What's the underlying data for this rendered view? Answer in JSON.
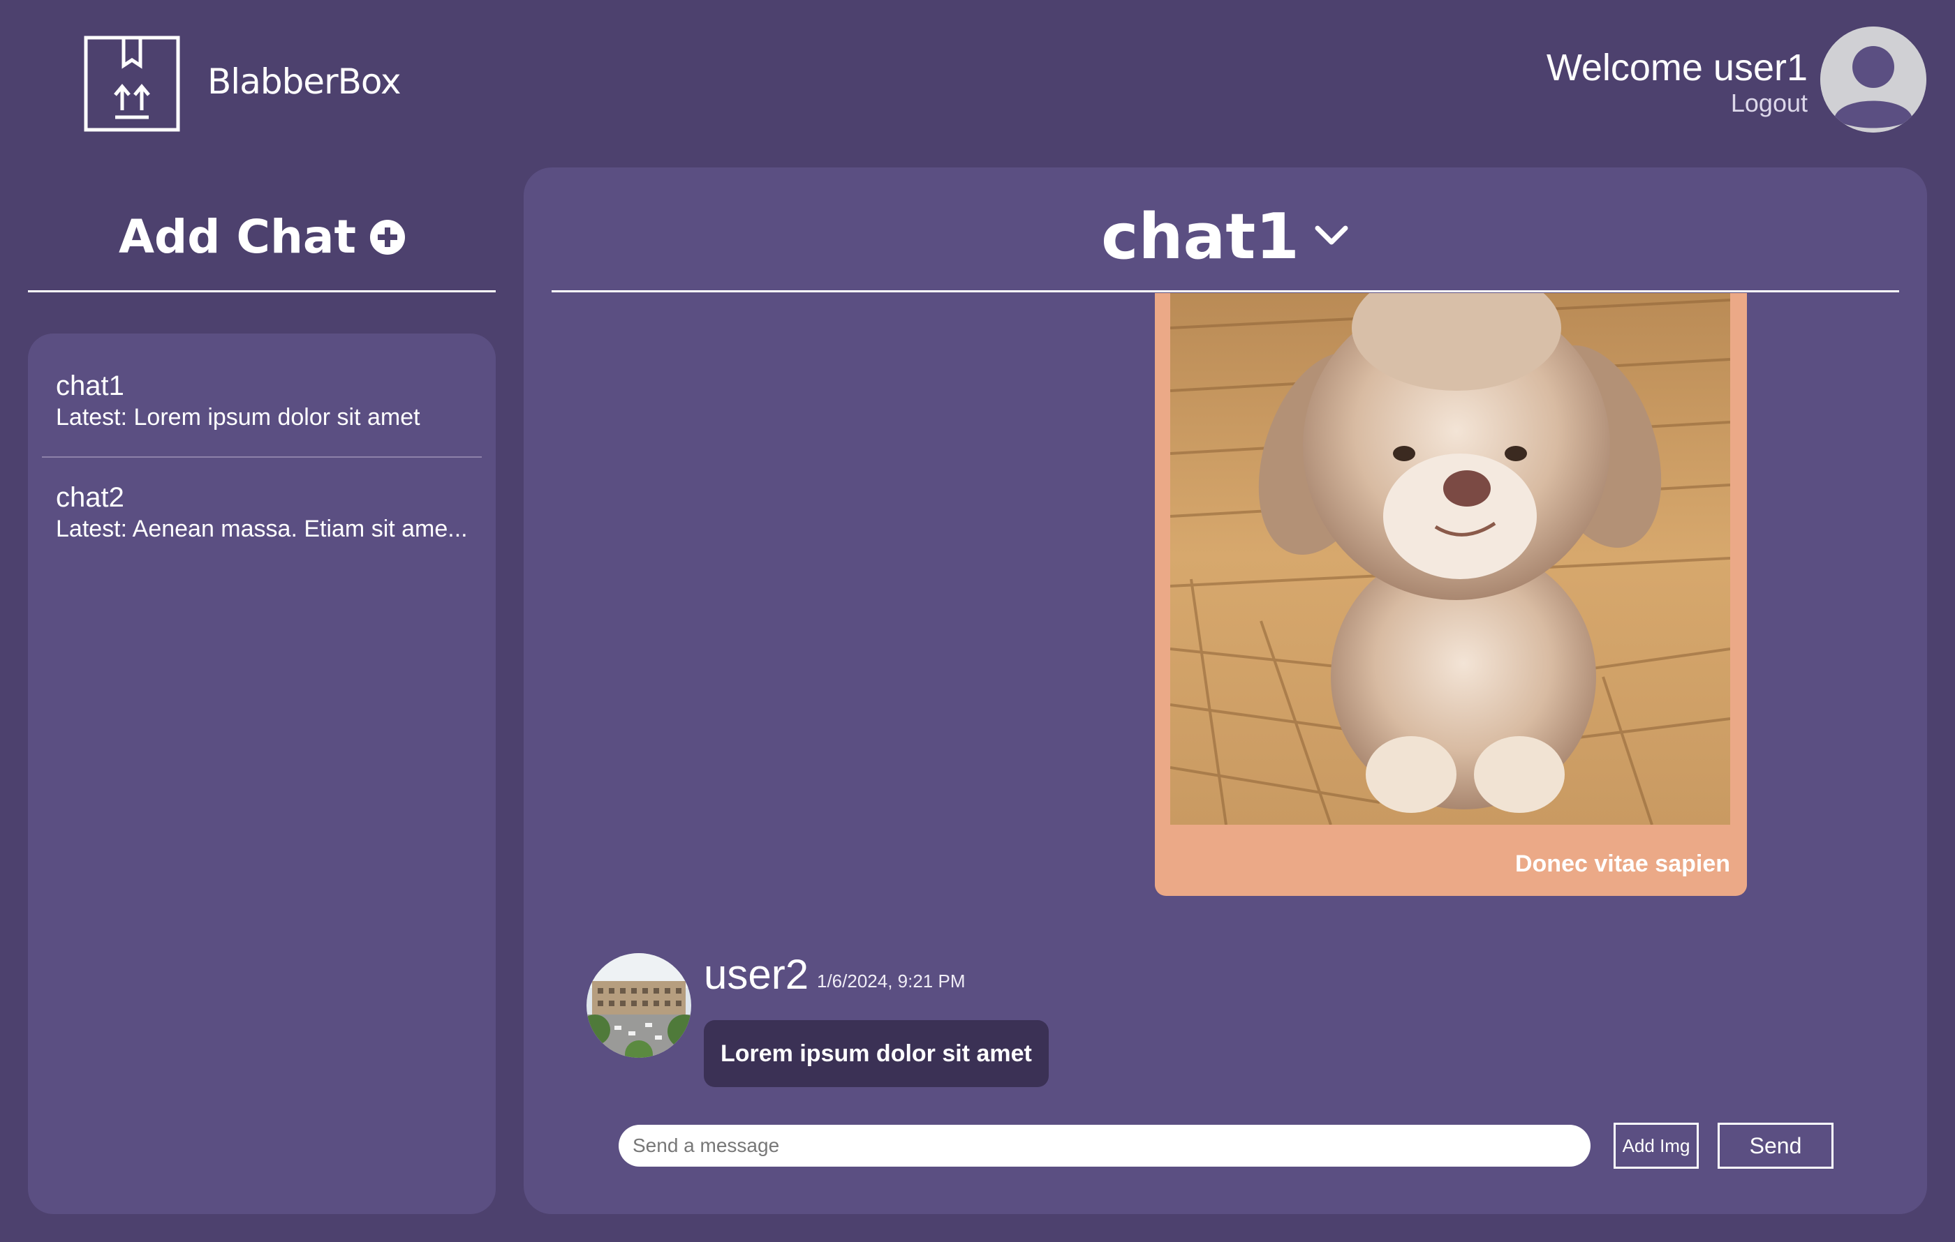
{
  "header": {
    "app_name": "BlabberBox",
    "welcome_text": "Welcome user1",
    "logout_label": "Logout",
    "logo_icon": "box-upload-icon",
    "avatar_icon": "user-avatar-icon"
  },
  "sidebar": {
    "add_chat_label": "Add Chat",
    "add_chat_icon": "plus-circle-icon",
    "chats": [
      {
        "name": "chat1",
        "latest": "Latest: Lorem ipsum dolor sit amet"
      },
      {
        "name": "chat2",
        "latest": "Latest: Aenean massa. Etiam sit ame..."
      }
    ]
  },
  "main": {
    "chat_title": "chat1",
    "chat_title_icon": "chevron-down-icon",
    "image_message": {
      "caption": "Donec vitae sapien"
    },
    "text_message": {
      "username": "user2",
      "timestamp": "1/6/2024, 9:21 PM",
      "text": "Lorem ipsum dolor sit amet"
    },
    "composer": {
      "placeholder": "Send a message",
      "value": "",
      "add_img_label": "Add Img",
      "send_label": "Send"
    }
  },
  "colors": {
    "background": "#4d416e",
    "panel": "#5b4f82",
    "image_card": "#eba987",
    "bubble": "#3b3155"
  }
}
